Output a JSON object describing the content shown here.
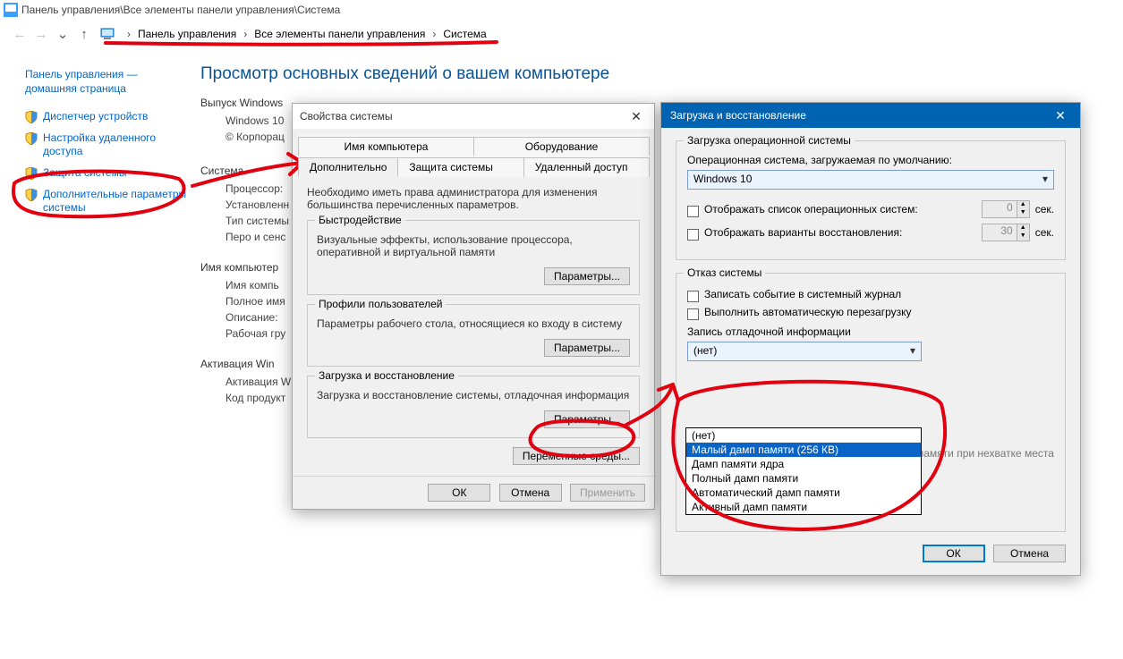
{
  "titlebar": "Панель управления\\Все элементы панели управления\\Система",
  "breadcrumb": {
    "a": "Панель управления",
    "b": "Все элементы панели управления",
    "c": "Система",
    "sep": "›"
  },
  "sidebar": {
    "home": "Панель управления — домашняя страница",
    "links": [
      "Диспетчер устройств",
      "Настройка удаленного доступа",
      "Защита системы",
      "Дополнительные параметры системы"
    ]
  },
  "content": {
    "heading": "Просмотр основных сведений о вашем компьютере",
    "sec1": "Выпуск Windows",
    "sec1a": "Windows 10",
    "sec1b": "© Корпорац",
    "sec2": "Система",
    "sec2a": "Процессор:",
    "sec2b": "Установленн (ОЗУ):",
    "sec2c": "Тип системы",
    "sec2d": "Перо и сенс",
    "sec3": "Имя компьютер",
    "sec3a": "Имя компь",
    "sec3b": "Полное имя",
    "sec3c": "Описание:",
    "sec3d": "Рабочая гру",
    "sec4": "Активация Win",
    "sec4a": "Активация W",
    "sec4b": "Код продукт"
  },
  "dlg1": {
    "title": "Свойства системы",
    "tabs": {
      "t1": "Имя компьютера",
      "t2": "Оборудование",
      "t3": "Дополнительно",
      "t4": "Защита системы",
      "t5": "Удаленный доступ"
    },
    "hint": "Необходимо иметь права администратора для изменения большинства перечисленных параметров.",
    "g1": {
      "title": "Быстродействие",
      "text": "Визуальные эффекты, использование процессора, оперативной и виртуальной памяти",
      "btn": "Параметры..."
    },
    "g2": {
      "title": "Профили пользователей",
      "text": "Параметры рабочего стола, относящиеся ко входу в систему",
      "btn": "Параметры..."
    },
    "g3": {
      "title": "Загрузка и восстановление",
      "text": "Загрузка и восстановление системы, отладочная информация",
      "btn": "Параметры..."
    },
    "envbtn": "Переменные среды...",
    "ok": "ОК",
    "cancel": "Отмена",
    "apply": "Применить"
  },
  "dlg2": {
    "title": "Загрузка и восстановление",
    "grpA": {
      "title": "Загрузка операционной системы",
      "lblDefault": "Операционная система, загружаемая по умолчанию:",
      "defaultOS": "Windows 10",
      "chkList": "Отображать список операционных систем:",
      "listSec": "0",
      "chkRecovery": "Отображать варианты восстановления:",
      "recSec": "30",
      "unit": "сек."
    },
    "grpB": {
      "title": "Отказ системы",
      "chkLog": "Записать событие в системный журнал",
      "chkRestart": "Выполнить автоматическую перезагрузку",
      "lblDump": "Запись отладочной информации",
      "select": "(нет)",
      "options": [
        "(нет)",
        "Малый дамп памяти (256 КВ)",
        "Дамп памяти ядра",
        "Полный дамп памяти",
        "Автоматический дамп памяти",
        "Активный дамп памяти"
      ],
      "footer": "Отключить автоматическое удаление дампов памяти при нехватке места на диске"
    },
    "ok": "ОК",
    "cancel": "Отмена"
  }
}
